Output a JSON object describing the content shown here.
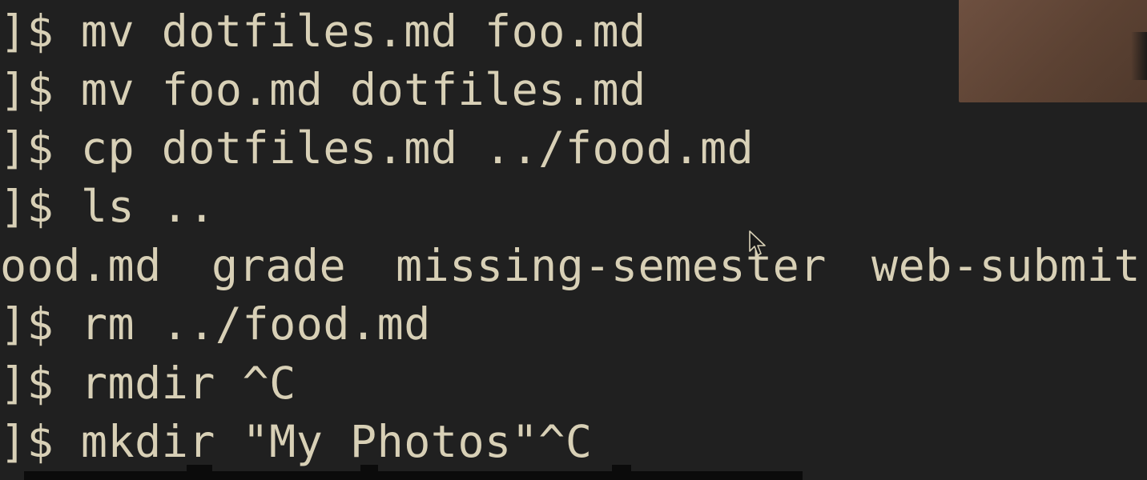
{
  "terminal": {
    "lines": [
      {
        "prompt": "]$",
        "command": "mv dotfiles.md foo.md"
      },
      {
        "prompt": "]$",
        "command": "mv foo.md dotfiles.md"
      },
      {
        "prompt": "]$",
        "command": "cp dotfiles.md ../food.md"
      },
      {
        "prompt": "]$",
        "command": "ls .."
      },
      {
        "prompt": "]$",
        "command": "rm ../food.md"
      },
      {
        "prompt": "]$",
        "command": "rmdir ^C"
      },
      {
        "prompt": "]$",
        "command": "mkdir \"My Photos\"^C"
      }
    ],
    "ls_output": [
      "ood.md",
      "grade",
      "missing-semester",
      "web-submit"
    ]
  },
  "overlay": {
    "webcam_colors": {
      "skin": "#6e5040",
      "shadow": "#1a1a1a"
    },
    "caption_bar_color": "#0b0b0b"
  },
  "theme": {
    "background": "#202020",
    "foreground": "#d8d0b6"
  }
}
